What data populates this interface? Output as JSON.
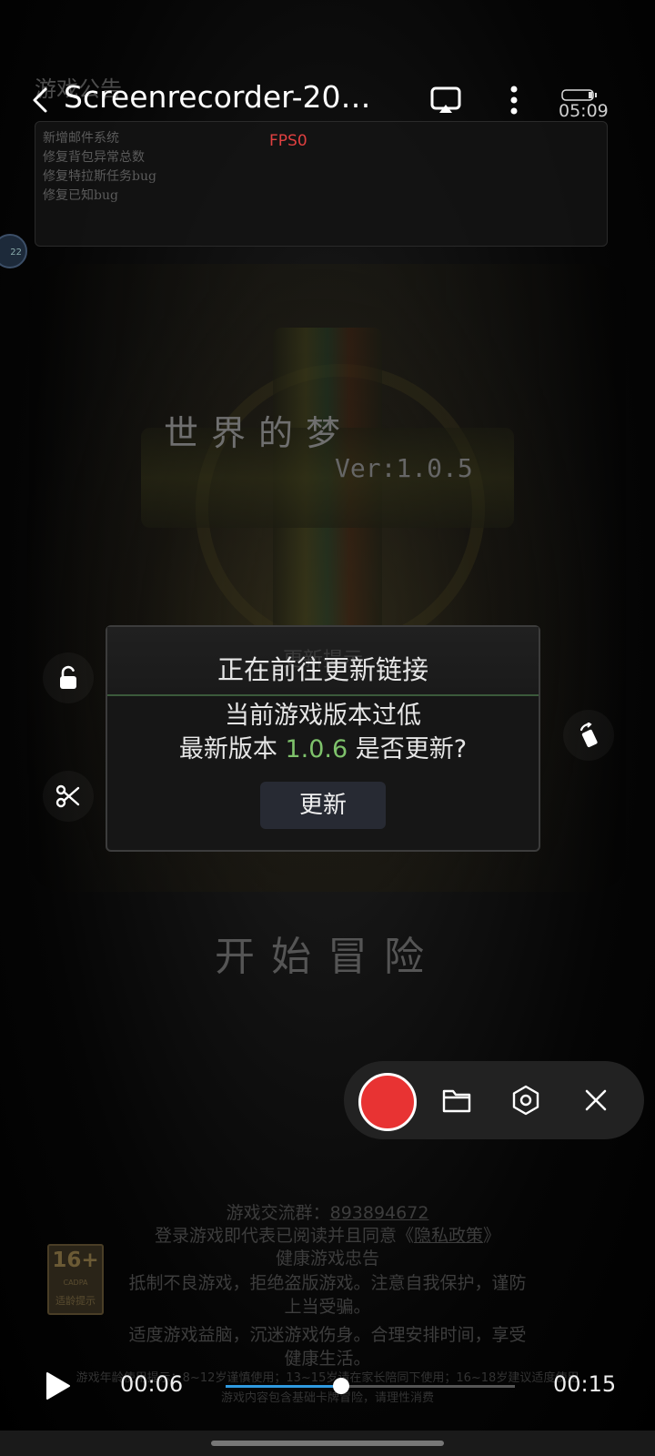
{
  "colors": {
    "accent_record": "#e83333",
    "progress": "#2f9ae0",
    "version_highlight": "#7ec26b",
    "fps": "#e04040"
  },
  "player": {
    "title": "Screenrecorder-20…",
    "status_time": "05:09",
    "icons": {
      "back": "chevron-left-icon",
      "cast": "cast-icon",
      "more": "more-vertical-icon",
      "battery": "battery-icon"
    },
    "current_time": "00:06",
    "total_time": "00:15",
    "progress_fraction": 0.4
  },
  "game": {
    "notice_title": "游戏公告",
    "notice_lines": [
      "新增邮件系统",
      "修复背包异常总数",
      "修复特拉斯任务bug",
      "修复已知bug"
    ],
    "fps": "FPS0",
    "edge_avatar": "22",
    "title": "世界的梦",
    "version": "Ver:1.0.5",
    "start_button": "开始冒险",
    "group_label": "游戏交流群：",
    "group_number": "893894672",
    "agree_prefix": "登录游戏即代表已阅读并且同意《",
    "privacy_link": "隐私政策",
    "agree_suffix": "》",
    "health_title1": "健康游戏忠告",
    "health_line1": "抵制不良游戏，拒绝盗版游戏。注意自我保护，谨防",
    "health_line2": "上当受骗。",
    "health_line3": "适度游戏益脑，沉迷游戏伤身。合理安排时间，享受",
    "health_line4": "健康生活。",
    "fine_print1": "游戏年龄使用提示：8~12岁谨慎使用；13~15岁请在家长陪同下使用；16~18岁建议适度使用",
    "fine_print2": "游戏内容包含基础卡牌冒险，请理性消费",
    "age": {
      "number": "16+",
      "org": "CADPA",
      "label": "适龄提示"
    }
  },
  "dialog": {
    "ghost_title": "更新提示",
    "title": "正在前往更新链接",
    "line1": "当前游戏版本过低",
    "line2_prefix": "最新版本 ",
    "line2_version": "1.0.6",
    "line2_suffix": " 是否更新?",
    "update_button": "更新"
  },
  "side_tools": {
    "lock": "unlock-icon",
    "cut": "scissors-icon",
    "rotate": "rotate-icon"
  },
  "recorder": {
    "record": "record-icon",
    "folder": "folder-icon",
    "settings": "settings-hexagon-icon",
    "close": "close-icon"
  }
}
